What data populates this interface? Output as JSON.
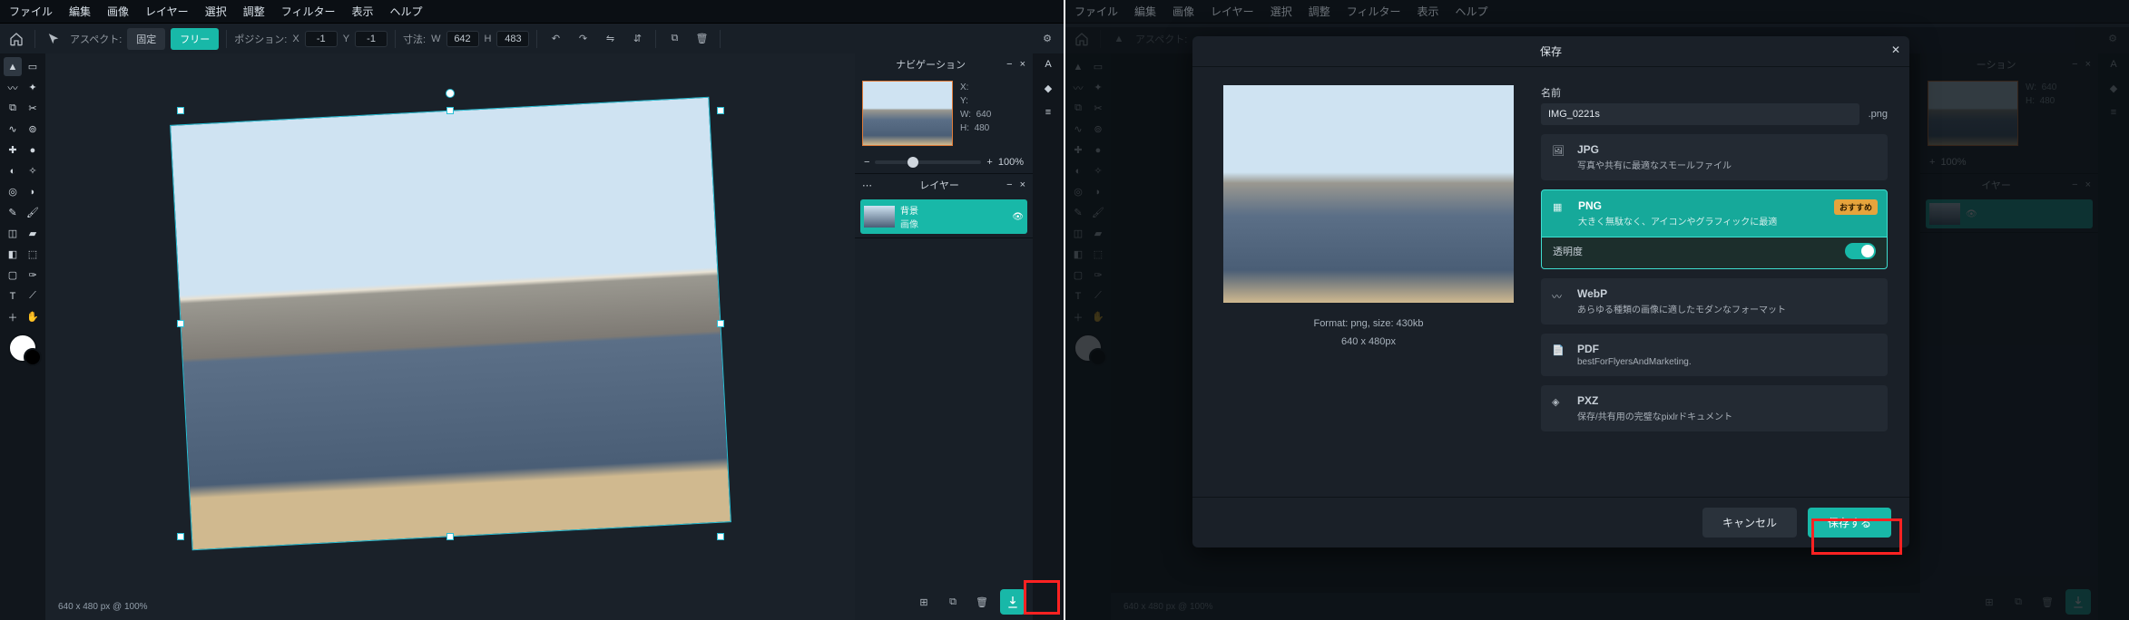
{
  "menu": [
    "ファイル",
    "編集",
    "画像",
    "レイヤー",
    "選択",
    "調整",
    "フィルター",
    "表示",
    "ヘルプ"
  ],
  "optbar": {
    "aspect_label": "アスペクト:",
    "fixed": "固定",
    "free": "フリー",
    "position_label": "ポジション:",
    "x_label": "X",
    "x_val": "-1",
    "y_label": "Y",
    "y_val": "-1",
    "size_label": "寸法:",
    "w_label": "W",
    "w_val": "642",
    "h_label": "H",
    "h_val": "483"
  },
  "footer": {
    "status": "640 x 480 px @ 100%"
  },
  "nav": {
    "title": "ナビゲーション",
    "x_label": "X:",
    "y_label": "Y:",
    "w_label": "W:",
    "w_val": "640",
    "h_label": "H:",
    "h_val": "480",
    "zoom": "100%"
  },
  "layers": {
    "title": "レイヤー",
    "item": {
      "name": "背景",
      "sub": "画像"
    }
  },
  "dialog": {
    "title": "保存",
    "name_label": "名前",
    "name_value": "IMG_0221s",
    "ext": ".png",
    "meta_fmt": "Format: png, size: 430kb",
    "meta_dim": "640 x 480px",
    "formats": {
      "jpg": {
        "name": "JPG",
        "desc": "写真や共有に最適なスモールファイル"
      },
      "png": {
        "name": "PNG",
        "desc": "大きく無駄なく、アイコンやグラフィックに最適",
        "badge": "おすすめ",
        "sub": "透明度"
      },
      "webp": {
        "name": "WebP",
        "desc": "あらゆる種類の画像に適したモダンなフォーマット"
      },
      "pdf": {
        "name": "PDF",
        "desc": "bestForFlyersAndMarketing."
      },
      "pxz": {
        "name": "PXZ",
        "desc": "保存/共有用の完璧なpixlrドキュメント"
      }
    },
    "cancel": "キャンセル",
    "save": "保存する"
  }
}
